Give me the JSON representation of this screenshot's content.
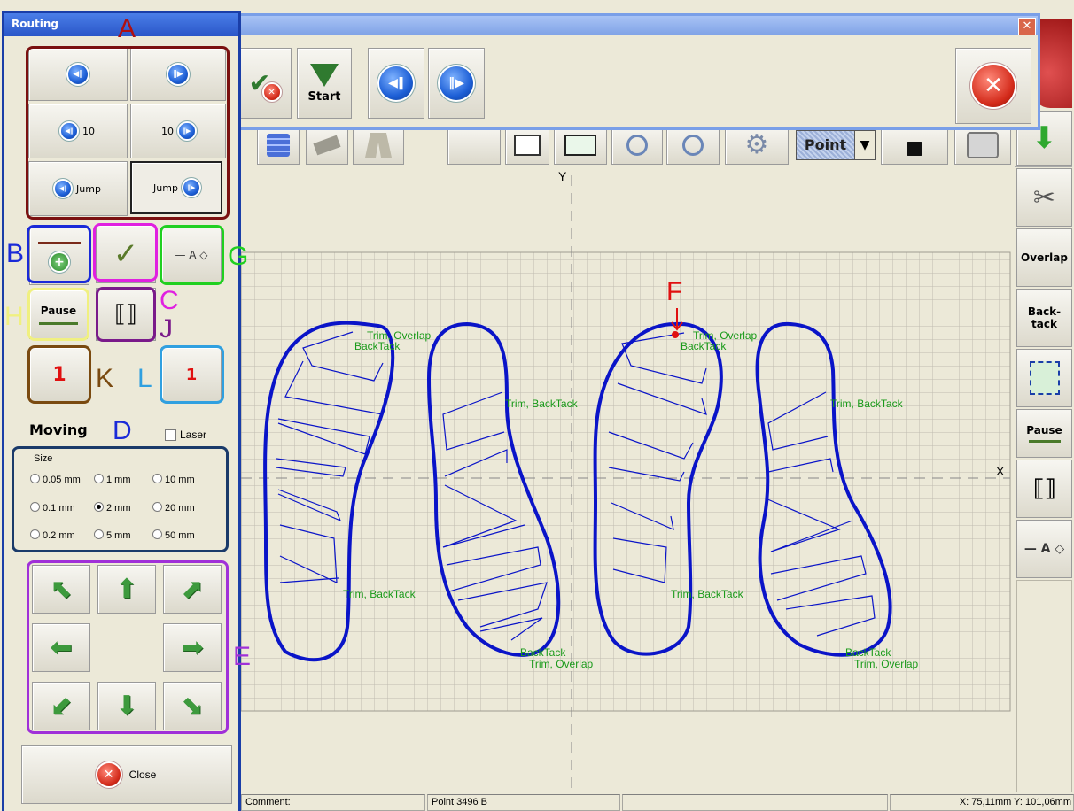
{
  "routing_panel": {
    "title": "Routing",
    "nav_buttons": {
      "ten_prev": "10",
      "ten_next": "10",
      "jump_prev": "Jump",
      "jump_next": "Jump"
    },
    "pause_label": "Pause",
    "moving": {
      "title": "Moving",
      "laser_label": "Laser",
      "size_legend": "Size",
      "sizes": [
        "0.05 mm",
        "1 mm",
        "10 mm",
        "0.1 mm",
        "2 mm",
        "20 mm",
        "0.2 mm",
        "5 mm",
        "50 mm"
      ],
      "selected_size": "2 mm"
    },
    "close_label": "Close"
  },
  "toolbar_popup": {
    "start_label": "Start"
  },
  "toolbar": {
    "mode_value": "Point"
  },
  "right_tools": {
    "overlap": "Overlap",
    "backtack": "Back-\ntack",
    "pause": "Pause"
  },
  "canvas": {
    "y_axis": "Y",
    "x_axis": "X",
    "labels": [
      "Trim, Overlap",
      "BackTack",
      "Trim, BackTack",
      "Trim, BackTack",
      "BackTack",
      "Trim, Overlap",
      "Trim, Overlap",
      "BackTack",
      "Trim, BackTack",
      "Trim, BackTack",
      "BackTack",
      "Trim, Overlap"
    ]
  },
  "annotations": {
    "A": "A",
    "B": "B",
    "C": "C",
    "D": "D",
    "E": "E",
    "F": "F",
    "G": "G",
    "H": "H",
    "J": "J",
    "K": "K",
    "L": "L"
  },
  "status_bar": {
    "comment": "Comment:",
    "point": "Point 3496 B",
    "coords": "X: 75,11mm Y: 101,06mm"
  },
  "colors": {
    "pattern": "#0a14c8",
    "labels_green": "#1a9a1a",
    "panel_border": "#1a3ea8",
    "annotation_red": "#b01010",
    "annotation_blue": "#1a2ad8"
  }
}
